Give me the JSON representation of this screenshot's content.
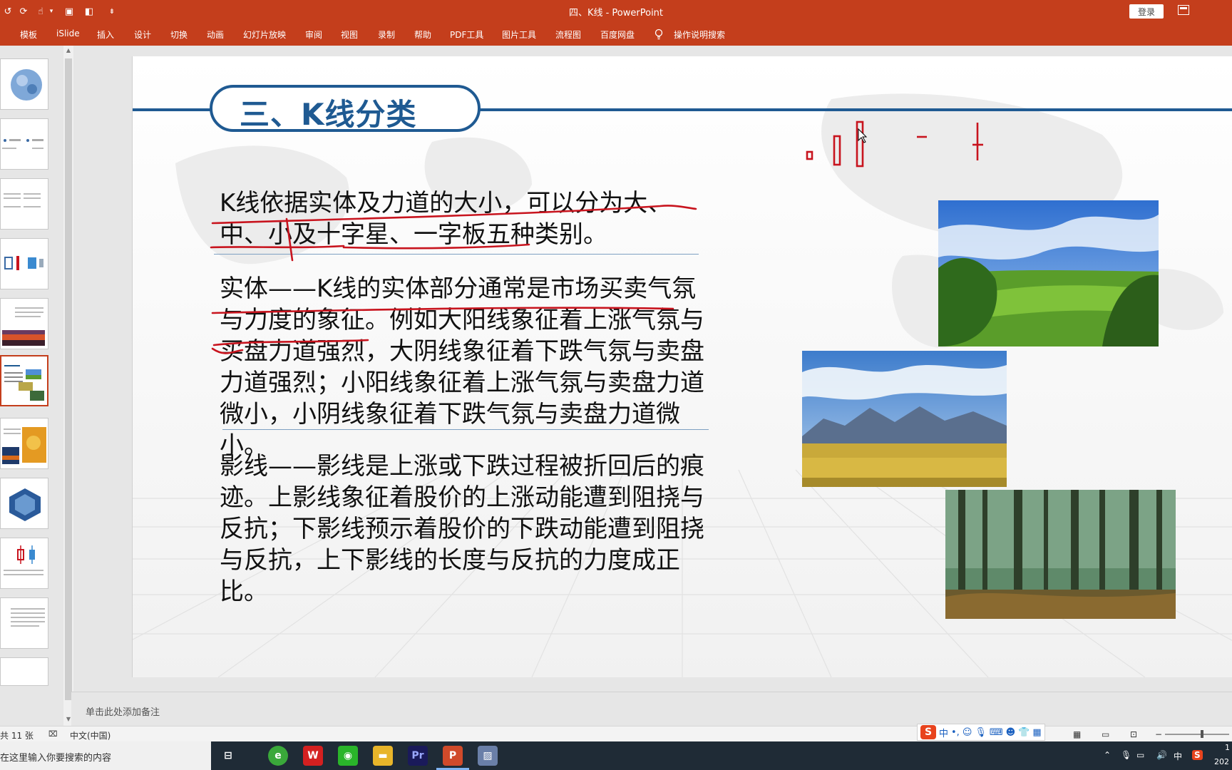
{
  "window": {
    "title": "四、K线 - PowerPoint",
    "login_label": "登录"
  },
  "ribbon": {
    "tabs": [
      "模板",
      "iSlide",
      "插入",
      "设计",
      "切换",
      "动画",
      "幻灯片放映",
      "审阅",
      "视图",
      "录制",
      "帮助",
      "PDF工具",
      "图片工具",
      "流程图",
      "百度网盘",
      "操作说明搜索"
    ]
  },
  "slide": {
    "title": "三、K线分类",
    "paragraphs": [
      "K线依据实体及力道的大小，可以分为大、中、小及十字星、一字板五种类别。",
      "实体——K线的实体部分通常是市场买卖气氛与力度的象征。例如大阳线象征着上涨气氛与买盘力道强烈，大阴线象征着下跌气氛与卖盘力道强烈；小阳线象征着上涨气氛与卖盘力道微小，小阴线象征着下跌气氛与卖盘力道微小。",
      "影线——影线是上涨或下跌过程被折回后的痕迹。上影线象征着股价的上涨动能遭到阻挠与反抗；下影线预示着股价的下跌动能遭到阻挠与反抗，上下影线的长度与反抗的力度成正比。"
    ],
    "photos": [
      "meadow-photo",
      "mountain-grassland-photo",
      "forest-photo"
    ]
  },
  "notes": {
    "placeholder": "单击此处添加备注"
  },
  "status": {
    "slide_count": "共 11 张",
    "language": "中文(中国)"
  },
  "ime": {
    "logo": "S",
    "mode": "中"
  },
  "taskbar": {
    "search_placeholder": "在这里输入你要搜索的内容",
    "apps": [
      "task-view",
      "360-browser",
      "wps",
      "wechat",
      "file-explorer",
      "premiere",
      "powerpoint",
      "photos"
    ],
    "tray_ime": "中",
    "tray_s": "S",
    "clock_top": "1",
    "clock_bottom": "202"
  },
  "colors": {
    "accent": "#c43e1c",
    "title_blue": "#1f5a92",
    "annotation_red": "#c8141e"
  }
}
